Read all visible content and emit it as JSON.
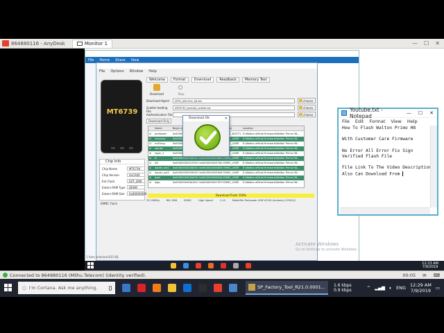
{
  "anydesk": {
    "session_title": "864880116 - AnyDesk",
    "tab_label": "Monitor 1",
    "status_text": "Connected to 864880116 (Milhu Telecom) (identity verified).",
    "right_time": "00:05"
  },
  "explorer": {
    "ribbon": [
      "File",
      "Home",
      "Share",
      "View"
    ]
  },
  "flash_tool": {
    "menu": [
      "File",
      "Options",
      "Window",
      "Help"
    ],
    "tabs": [
      "Welcome",
      "Format",
      "Download",
      "Readback",
      "Memory Test"
    ],
    "download_label": "Download",
    "stop_label": "Stop",
    "phone_brand": "MT6739",
    "fields": [
      {
        "label": "Download-Agent",
        "value": "\\MTK_AllInOne_DA.bin",
        "button": "choose"
      },
      {
        "label": "Scatter-loading File",
        "value": "\\MT6739_Android_scatter.txt",
        "button": "choose"
      },
      {
        "label": "Authentication File",
        "value": "",
        "button": "choose"
      }
    ],
    "download_mode": "Download Only",
    "table_headers": [
      "",
      "Name",
      "Begin Address",
      "End Address",
      "Region",
      "Location"
    ],
    "table_rows": [
      [
        "☑",
        "preloader",
        "0x0000000000000000",
        "0x000000000003d7ff",
        "EMMC_BOOT1",
        "E:\\Walton official firmware\\Walton Primo H8..."
      ],
      [
        "☑",
        "recovery",
        "0x0000000000008000",
        "0x0000000001b8cfff",
        "EMMC_USER",
        "E:\\Walton official firmware\\Walton Primo H8..."
      ],
      [
        "☑",
        "md1img",
        "0x0000000002200000",
        "0x0000000002af7fff",
        "EMMC_USER",
        "E:\\Walton official firmware\\Walton Primo H8..."
      ],
      [
        "☑",
        "spmfw",
        "0x0000000003e00000",
        "0x0000000003e037ff",
        "EMMC_USER",
        "E:\\Walton official firmware\\Walton Primo H8..."
      ],
      [
        "☑",
        "sspm_1",
        "0x0000000003f00000",
        "0x0000000003f0fbff",
        "EMMC_USER",
        "E:\\Walton official firmware\\Walton Primo H8..."
      ],
      [
        "☑",
        "lk",
        "0x0000000005600000",
        "0x000000000566d7ff",
        "EMMC_USER",
        "E:\\Walton official firmware\\Walton Primo H8..."
      ],
      [
        "☑",
        "lk2",
        "0x0000000005700000",
        "0x000000000576d7ff",
        "EMMC_USER",
        "E:\\Walton official firmware\\Walton Primo H8..."
      ],
      [
        "☑",
        "loader_ext1",
        "0x0000000005800000",
        "0x00000000058087ff",
        "EMMC_USER",
        "E:\\Walton official firmware\\Walton Primo H8..."
      ],
      [
        "☑",
        "loader_ext2",
        "0x0000000005900000",
        "0x00000000059087ff",
        "EMMC_USER",
        "E:\\Walton official firmware\\Walton Primo H8..."
      ],
      [
        "☑",
        "boot",
        "0x0000000005a00000",
        "0x00000000063a2fff",
        "EMMC_USER",
        "E:\\Walton official firmware\\Walton Primo H8..."
      ],
      [
        "☑",
        "logo",
        "0x0000000006c00000",
        "0x00000000073f7fff",
        "EMMC_USER",
        "E:\\Walton official firmware\\Walton Primo H8..."
      ]
    ],
    "chip_info": {
      "title": "Chip Info",
      "rows": [
        [
          "Chip Name",
          "MT6739"
        ],
        [
          "Chip Version",
          "0xCA00"
        ],
        [
          "Ext Clock",
          "EXT_26M"
        ],
        [
          "Extern RAM Type",
          "DRAM"
        ],
        [
          "Extern RAM Size",
          "0x80000000"
        ]
      ],
      "flash_type": "EMMC Flash"
    },
    "progress_text": "Download Flash 100%",
    "statusbar": [
      "25.13MB/s",
      "BB: 5MB",
      "EMMC",
      "High Speed",
      "1:14",
      "MediaTek PreLoader USB VCOM (Android) (COM12)"
    ],
    "bottom_status": "1 item selected 815 KB"
  },
  "dialog": {
    "title": "Download Ok"
  },
  "notepad": {
    "title": "Youtube.txt - Notepad",
    "menu": [
      "File",
      "Edit",
      "Format",
      "View",
      "Help"
    ],
    "lines": [
      "How To Flash Walton Primo H8",
      "",
      "With Customer Care Firmware",
      "",
      "No Error All Error Fix Sign",
      "Verified Flash File",
      "",
      "File Link To The Video Description",
      "Also Can Download From "
    ]
  },
  "watermark": {
    "title": "Activate Windows",
    "subtitle": "Go to Settings to activate Windows."
  },
  "remote_taskbar": {
    "time": "12:23 AM",
    "date": "7/9/2019"
  },
  "local_taskbar": {
    "search_placeholder": "I'm Cortana. Ask me anything.",
    "active_app": "SP_Factory_Tool_R21.0.0001...",
    "net_up": "1.6 kbps",
    "net_down": "0.9 kbps",
    "time": "12:29 AM",
    "date": "7/9/2019",
    "language": "ENG"
  }
}
